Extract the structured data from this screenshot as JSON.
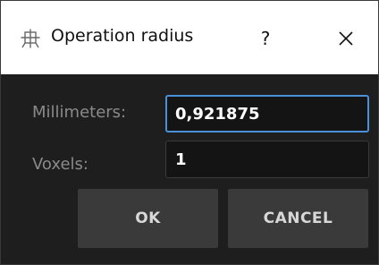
{
  "window": {
    "title": "Operation radius",
    "help_label": "?",
    "icon": "operation-radius-icon",
    "close_icon": "close-icon"
  },
  "form": {
    "millimeters_label": "Millimeters:",
    "millimeters_value": "0,921875",
    "voxels_label": "Voxels:",
    "voxels_value": "1"
  },
  "buttons": {
    "ok_label": "OK",
    "cancel_label": "CANCEL"
  },
  "colors": {
    "focus_border": "#4a90d9",
    "background": "#1e1e1e",
    "button": "#3a3a3a"
  }
}
